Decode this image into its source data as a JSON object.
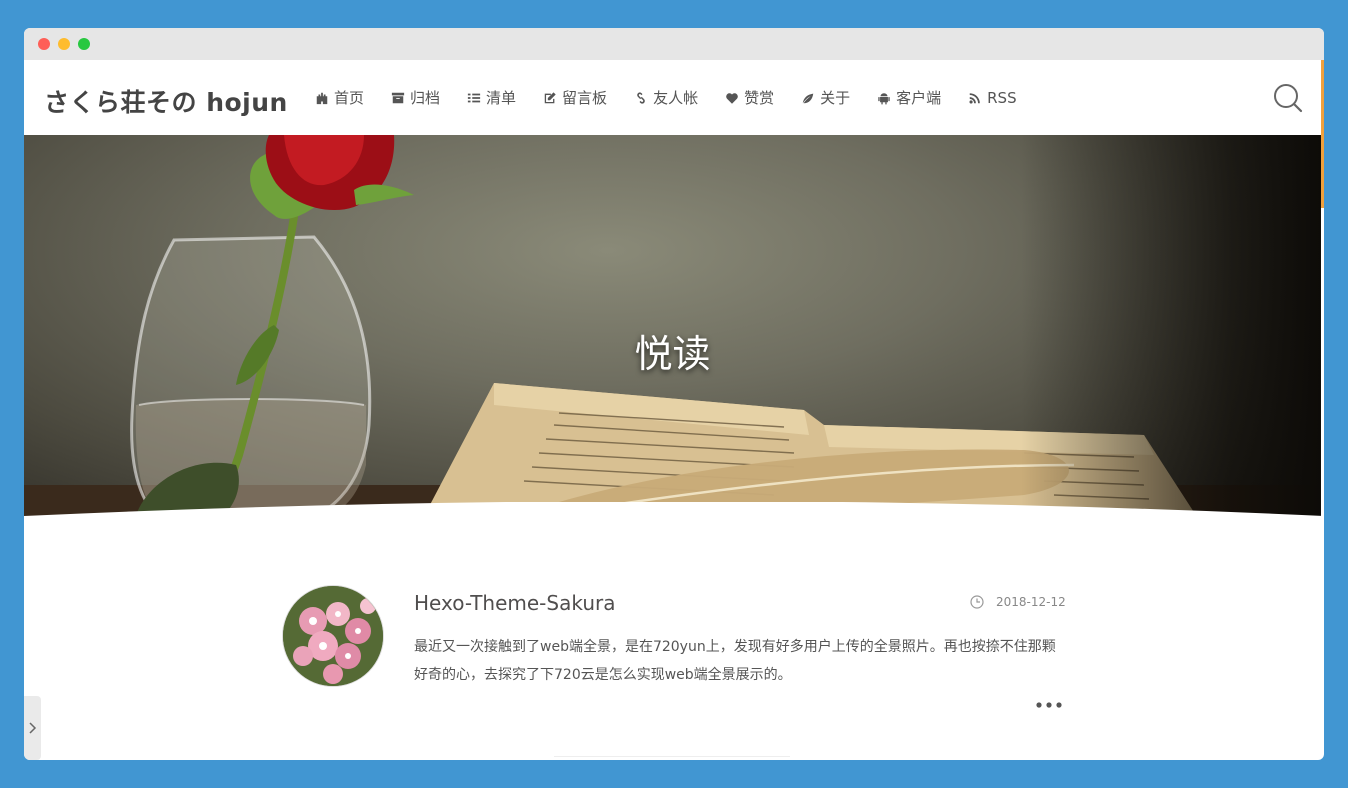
{
  "site": {
    "title": "さくら荘その hojun"
  },
  "nav": {
    "items": [
      {
        "label": "首页",
        "icon": "fort-icon"
      },
      {
        "label": "归档",
        "icon": "archive-icon"
      },
      {
        "label": "清单",
        "icon": "list-icon"
      },
      {
        "label": "留言板",
        "icon": "edit-icon"
      },
      {
        "label": "友人帐",
        "icon": "link-icon"
      },
      {
        "label": "赞赏",
        "icon": "heart-icon"
      },
      {
        "label": "关于",
        "icon": "leaf-icon"
      },
      {
        "label": "客户端",
        "icon": "android-icon"
      },
      {
        "label": "RSS",
        "icon": "rss-icon"
      }
    ]
  },
  "banner": {
    "title": "悦读"
  },
  "post": {
    "title": "Hexo-Theme-Sakura",
    "date": "2018-12-12",
    "excerpt": "最近又一次接触到了web端全景，是在720yun上，发现有好多用户上传的全景照片。再也按捺不住那颗好奇的心，去探究了下720云是怎么实现web端全景展示的。"
  },
  "colors": {
    "background": "#4196d2",
    "accent": "#f0a13e",
    "text": "#555555"
  }
}
